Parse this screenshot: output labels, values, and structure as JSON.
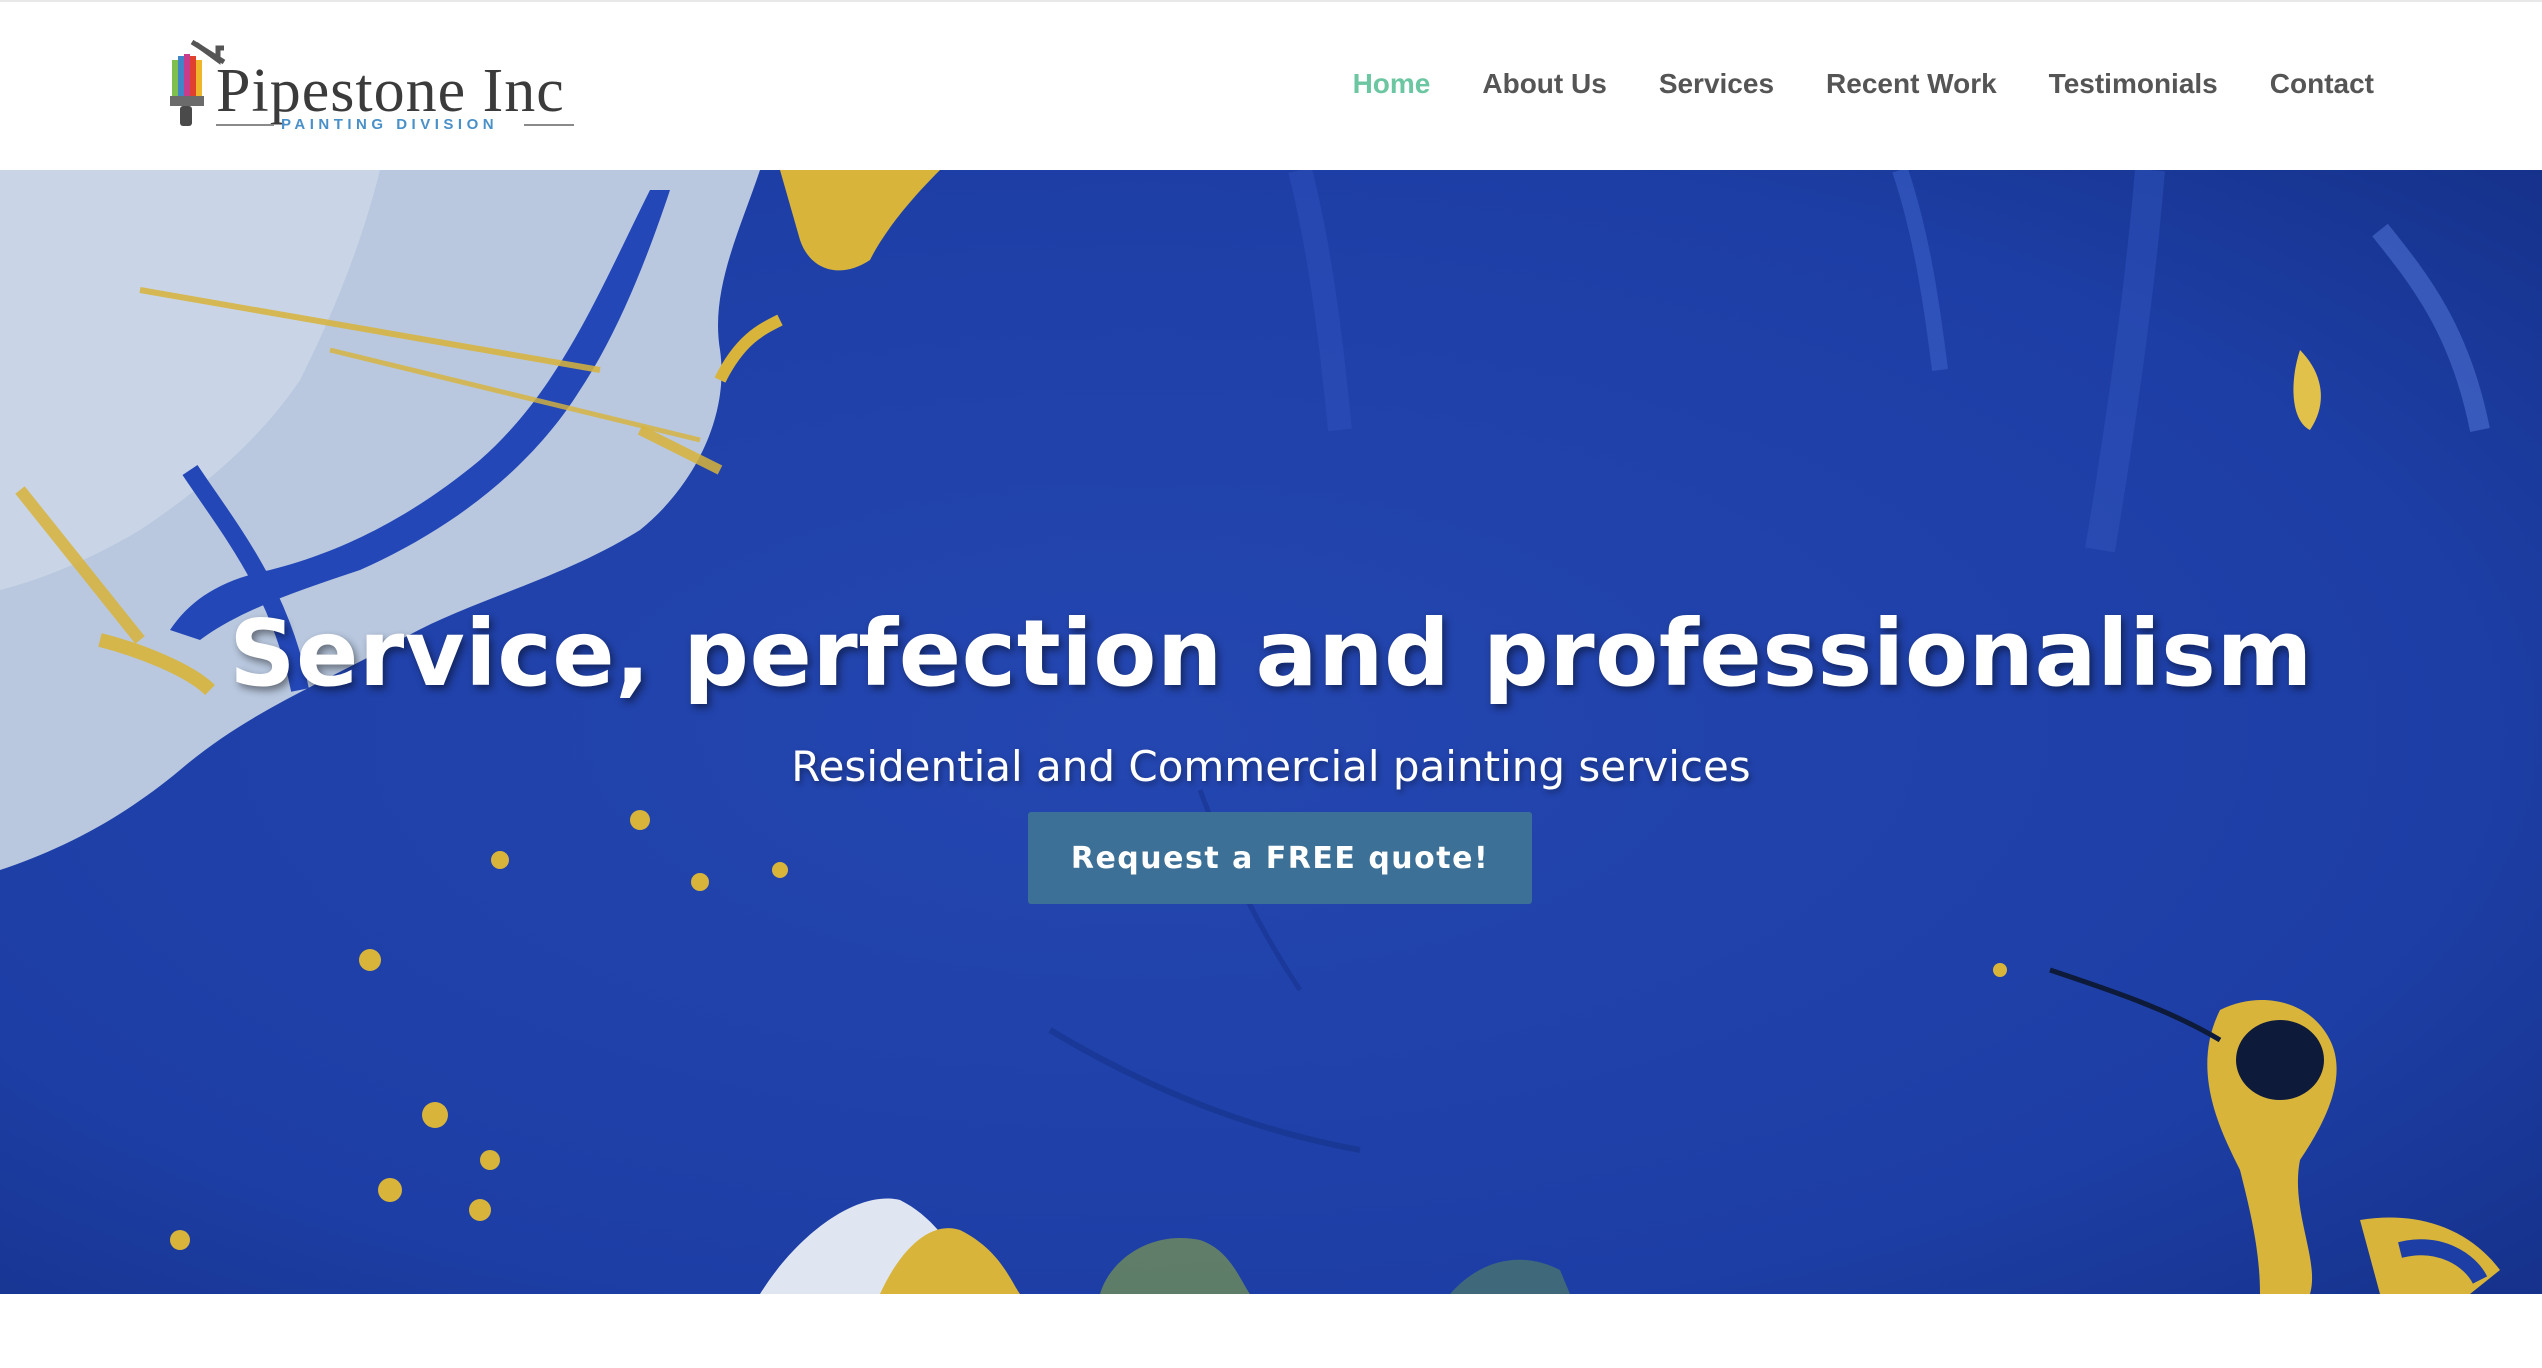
{
  "brand": {
    "name": "Pipestone Inc",
    "tagline": "PAINTING DIVISION"
  },
  "nav": {
    "items": [
      {
        "label": "Home",
        "active": true
      },
      {
        "label": "About Us",
        "active": false
      },
      {
        "label": "Services",
        "active": false
      },
      {
        "label": "Recent Work",
        "active": false
      },
      {
        "label": "Testimonials",
        "active": false
      },
      {
        "label": "Contact",
        "active": false
      }
    ]
  },
  "hero": {
    "title": "Service, perfection and professionalism",
    "subtitle": "Residential and Commercial painting services",
    "cta_label": "Request a FREE quote!",
    "background": "blue-yellow-paint-splash-image"
  },
  "colors": {
    "accent_active_nav": "#6cc6a2",
    "nav_text": "#555555",
    "cta_background": "#3d7096",
    "hero_blue": "#1f3fa8",
    "paint_yellow": "#d8b43a",
    "logo_blue": "#4a90c8"
  }
}
